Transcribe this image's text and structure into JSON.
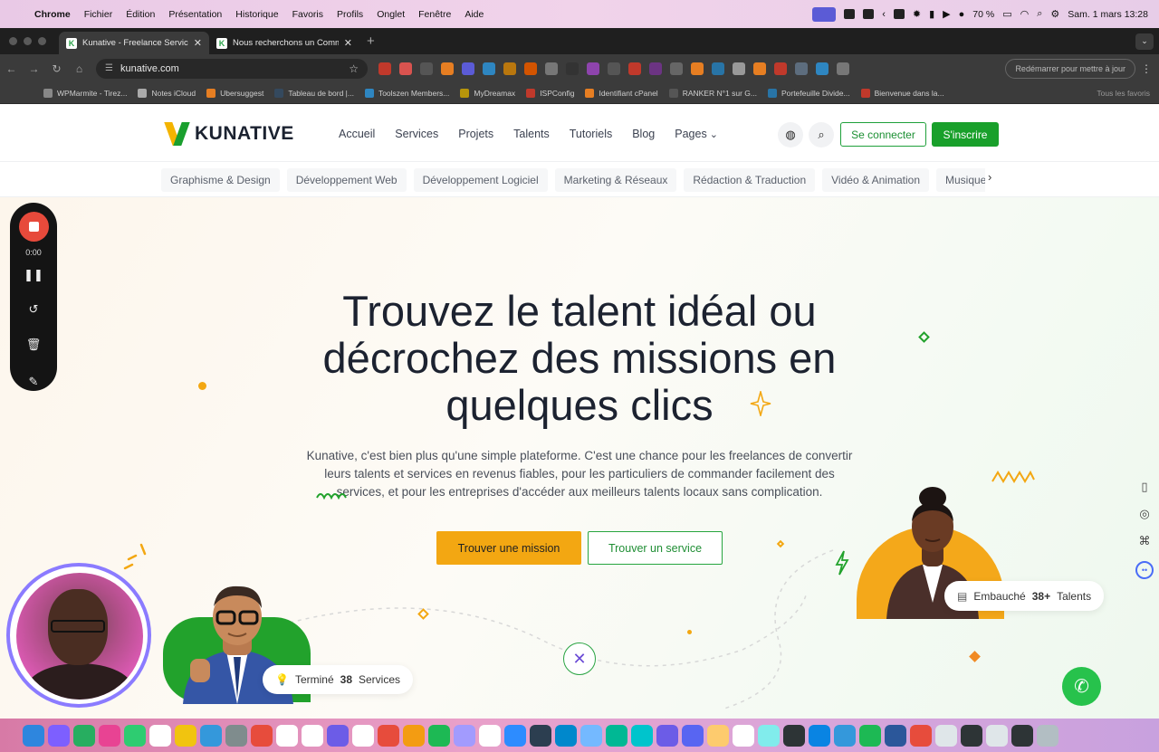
{
  "menubar": {
    "app": "Chrome",
    "items": [
      "Fichier",
      "Édition",
      "Présentation",
      "Historique",
      "Favoris",
      "Profils",
      "Onglet",
      "Fenêtre",
      "Aide"
    ],
    "battery": "70 %",
    "clock": "Sam. 1 mars 13:28"
  },
  "browser": {
    "tabs": [
      {
        "title": "Kunative - Freelance Services"
      },
      {
        "title": "Nous recherchons un Commu"
      }
    ],
    "url": "kunative.com",
    "restart_label": "Redémarrer pour mettre à jour",
    "bookmarks": [
      "WPMarmite - Tirez...",
      "Notes iCloud",
      "Ubersuggest",
      "Tableau de bord |...",
      "Toolszen Members...",
      "MyDreamax",
      "ISPConfig",
      "Identifiant cPanel",
      "RANKER N°1 sur G...",
      "Portefeuille Divide...",
      "Bienvenue dans la..."
    ],
    "all_bookmarks": "Tous les favoris"
  },
  "site": {
    "logo": "KUNATIVE",
    "nav": [
      "Accueil",
      "Services",
      "Projets",
      "Talents",
      "Tutoriels",
      "Blog",
      "Pages"
    ],
    "login": "Se connecter",
    "signup": "S'inscrire",
    "categories": [
      "Graphisme & Design",
      "Développement Web",
      "Développement Logiciel",
      "Marketing & Réseaux",
      "Rédaction & Traduction",
      "Vidéo & Animation",
      "Musique & Audio"
    ],
    "hero": {
      "title": "Trouvez le talent idéal ou décrochez des missions en quelques clics",
      "description": "Kunative, c'est bien plus qu'une simple plateforme. C'est une chance pour les freelances de convertir leurs talents et services en revenus fiables, pour les particuliers de commander facilement des services, et pour les entreprises d'accéder aux meilleurs talents locaux sans complication.",
      "cta_primary": "Trouver une mission",
      "cta_secondary": "Trouver un service",
      "badge_services_prefix": "Terminé",
      "badge_services_count": "38",
      "badge_services_suffix": "Services",
      "badge_talents_prefix": "Embauché",
      "badge_talents_count": "38+",
      "badge_talents_suffix": "Talents"
    }
  },
  "recorder": {
    "time": "0:00"
  },
  "colors": {
    "brand_green": "#19a02b",
    "brand_yellow": "#f3a712",
    "record_red": "#e74a3b"
  }
}
